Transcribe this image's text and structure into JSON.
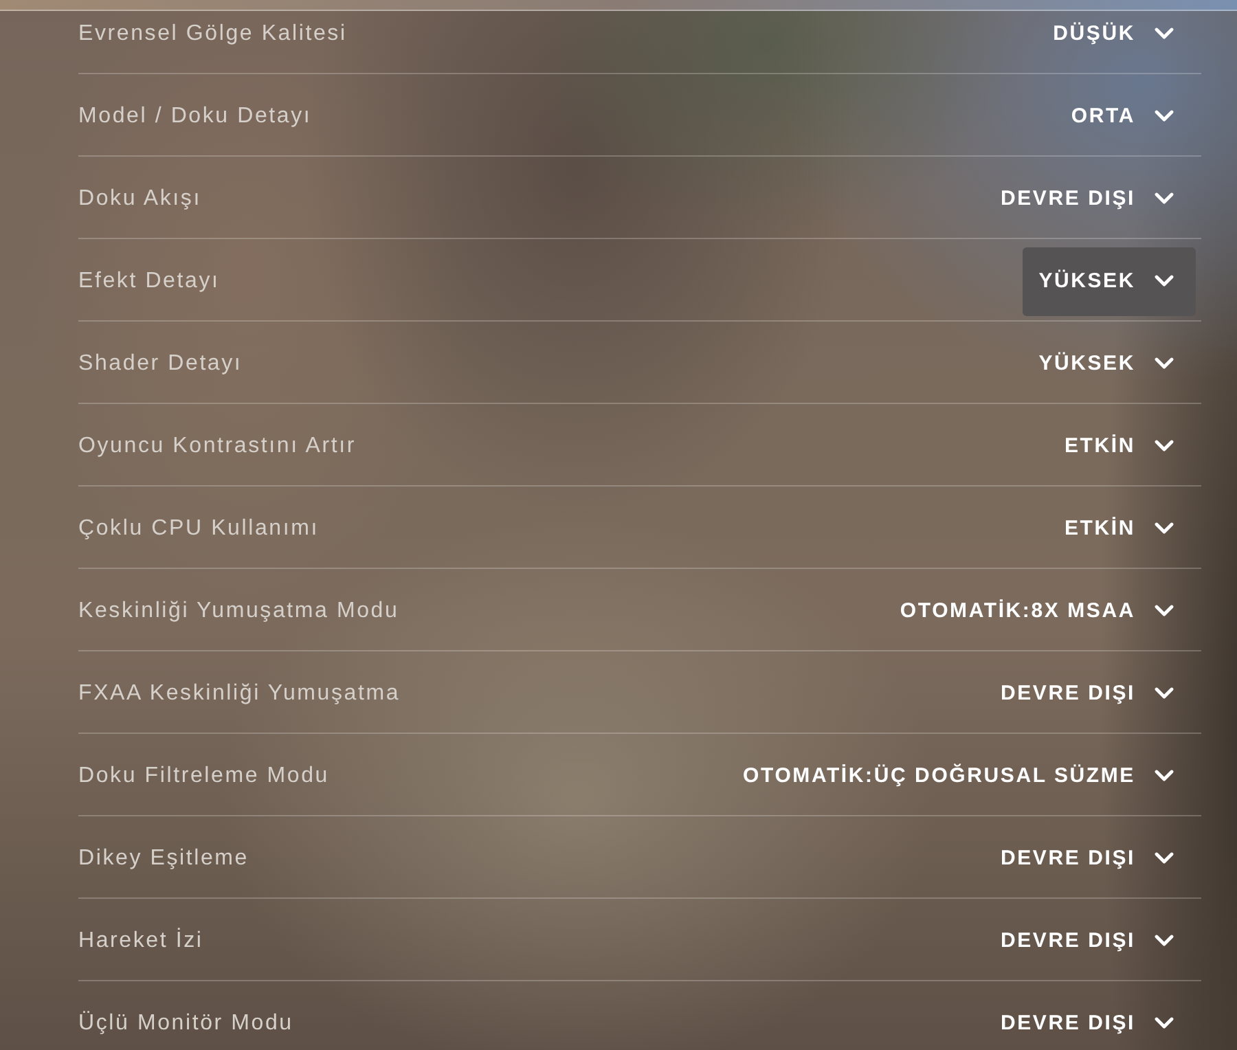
{
  "settings": [
    {
      "label": "Evrensel Gölge Kalitesi",
      "value": "DÜŞÜK",
      "hovered": false
    },
    {
      "label": "Model / Doku Detayı",
      "value": "ORTA",
      "hovered": false
    },
    {
      "label": "Doku Akışı",
      "value": "DEVRE DIŞI",
      "hovered": false
    },
    {
      "label": "Efekt Detayı",
      "value": "YÜKSEK",
      "hovered": true
    },
    {
      "label": "Shader Detayı",
      "value": "YÜKSEK",
      "hovered": false
    },
    {
      "label": "Oyuncu Kontrastını Artır",
      "value": "ETKİN",
      "hovered": false
    },
    {
      "label": "Çoklu CPU Kullanımı",
      "value": "ETKİN",
      "hovered": false
    },
    {
      "label": "Keskinliği Yumuşatma Modu",
      "value": "OTOMATİK:8X MSAA",
      "hovered": false
    },
    {
      "label": "FXAA Keskinliği Yumuşatma",
      "value": "DEVRE DIŞI",
      "hovered": false
    },
    {
      "label": "Doku Filtreleme Modu",
      "value": "OTOMATİK:ÜÇ DOĞRUSAL SÜZME",
      "hovered": false
    },
    {
      "label": "Dikey Eşitleme",
      "value": "DEVRE DIŞI",
      "hovered": false
    },
    {
      "label": "Hareket İzi",
      "value": "DEVRE DIŞI",
      "hovered": false
    },
    {
      "label": "Üçlü Monitör Modu",
      "value": "DEVRE DIŞI",
      "hovered": false
    }
  ]
}
